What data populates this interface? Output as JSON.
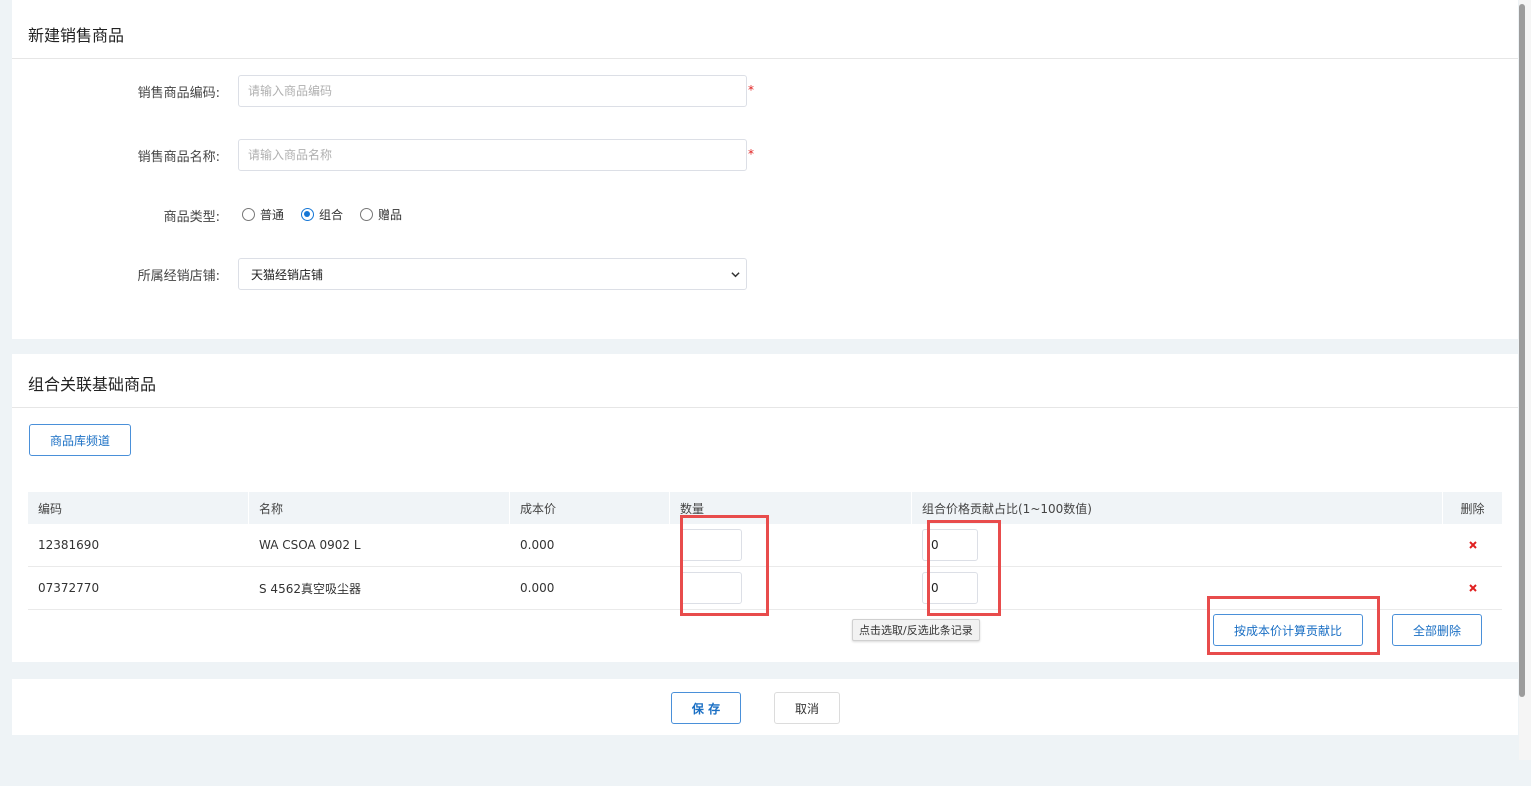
{
  "form": {
    "title": "新建销售商品",
    "code_label": "销售商品编码:",
    "code_placeholder": "请输入商品编码",
    "name_label": "销售商品名称:",
    "name_placeholder": "请输入商品名称",
    "required_mark": "*",
    "type_label": "商品类型:",
    "type_options": [
      {
        "label": "普通",
        "checked": false
      },
      {
        "label": "组合",
        "checked": true
      },
      {
        "label": "赠品",
        "checked": false
      }
    ],
    "store_label": "所属经销店铺:",
    "store_selected": "天猫经销店铺"
  },
  "combo": {
    "title": "组合关联基础商品",
    "library_button": "商品库频道",
    "columns": [
      "编码",
      "名称",
      "成本价",
      "数量",
      "组合价格贡献占比(1~100数值)",
      "删除"
    ],
    "rows": [
      {
        "code": "12381690",
        "name": "WA CSOA 0902 L",
        "cost": "0.000",
        "qty": "",
        "ratio": "0"
      },
      {
        "code": "07372770",
        "name": "S 4562真空吸尘器",
        "cost": "0.000",
        "qty": "",
        "ratio": "0"
      }
    ],
    "tooltip": "点击选取/反选此条记录",
    "calc_button": "按成本价计算贡献比",
    "delete_all_button": "全部删除"
  },
  "footer": {
    "save_button": "保 存",
    "cancel_button": "取消"
  },
  "colors": {
    "accent": "#1677d6",
    "highlight": "#e84c4c",
    "delete": "#e02020"
  },
  "icons": [
    "chevron-down-icon",
    "delete-x-icon"
  ]
}
